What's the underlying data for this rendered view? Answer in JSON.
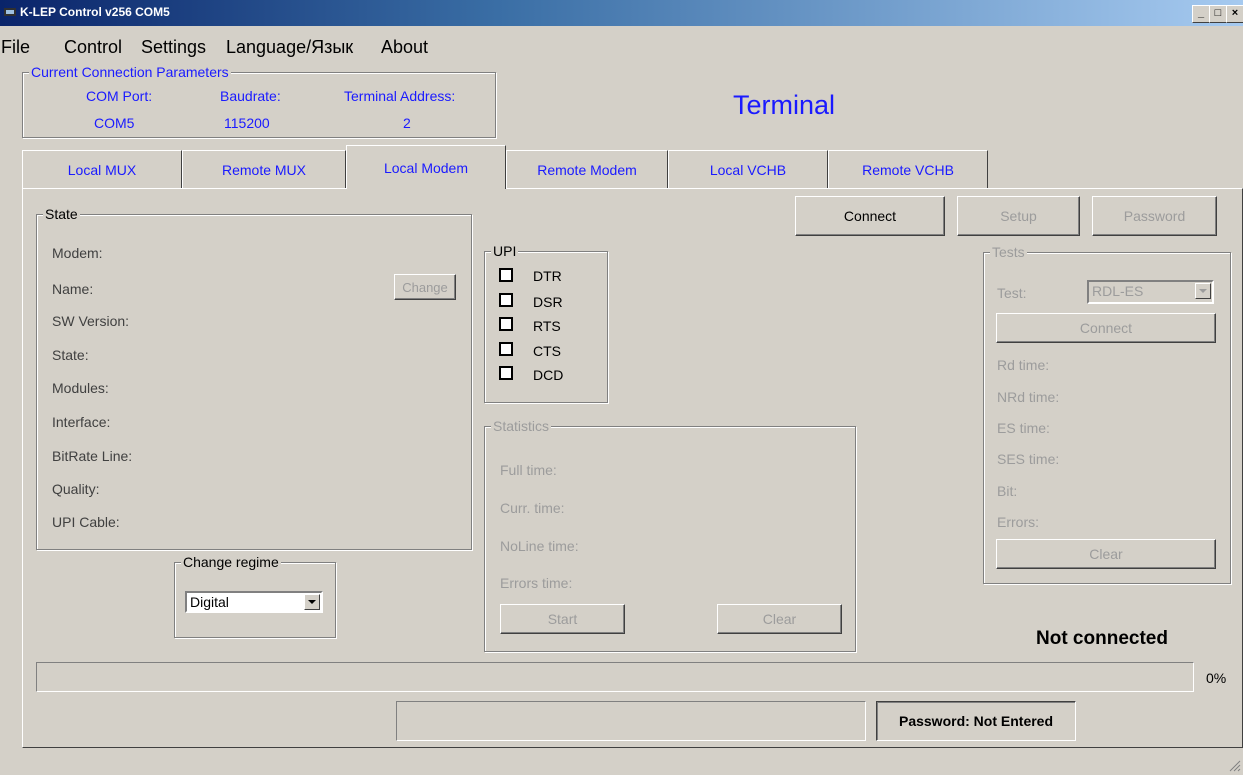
{
  "window": {
    "title": "K-LEP Control v256 COM5"
  },
  "menu": {
    "items": [
      "File",
      "Control",
      "Settings",
      "Language/Язык",
      "About"
    ]
  },
  "connection": {
    "legend": "Current Connection Parameters",
    "com_port_label": "COM Port:",
    "com_port_value": "COM5",
    "baudrate_label": "Baudrate:",
    "baudrate_value": "115200",
    "terminal_address_label": "Terminal Address:",
    "terminal_address_value": "2"
  },
  "heading": "Terminal",
  "tabs": [
    {
      "label": "Local MUX",
      "active": false
    },
    {
      "label": "Remote MUX",
      "active": false
    },
    {
      "label": "Local Modem",
      "active": true
    },
    {
      "label": "Remote Modem",
      "active": false
    },
    {
      "label": "Local VCHB",
      "active": false
    },
    {
      "label": "Remote VCHB",
      "active": false
    }
  ],
  "toolbar": {
    "connect": "Connect",
    "setup": "Setup",
    "password": "Password"
  },
  "state": {
    "legend": "State",
    "fields": [
      "Modem:",
      "Name:",
      "SW Version:",
      "State:",
      "Modules:",
      "Interface:",
      "BitRate Line:",
      "Quality:",
      "UPI Cable:"
    ],
    "change_button": "Change"
  },
  "change_regime": {
    "legend": "Change regime",
    "selected": "Digital"
  },
  "upi": {
    "legend": "UPI",
    "signals": [
      "DTR",
      "DSR",
      "RTS",
      "CTS",
      "DCD"
    ]
  },
  "statistics": {
    "legend": "Statistics",
    "fields": [
      "Full time:",
      "Curr. time:",
      "NoLine time:",
      "Errors time:"
    ],
    "start_button": "Start",
    "clear_button": "Clear"
  },
  "tests": {
    "legend": "Tests",
    "test_label": "Test:",
    "test_value": "RDL-ES",
    "connect_button": "Connect",
    "fields": [
      "Rd time:",
      "NRd time:",
      "ES time:",
      "SES time:",
      "Bit:",
      "Errors:"
    ],
    "clear_button": "Clear"
  },
  "status": {
    "connection": "Not connected",
    "progress_percent": "0%",
    "progress_value": 0,
    "password_status": "Password: Not Entered"
  }
}
